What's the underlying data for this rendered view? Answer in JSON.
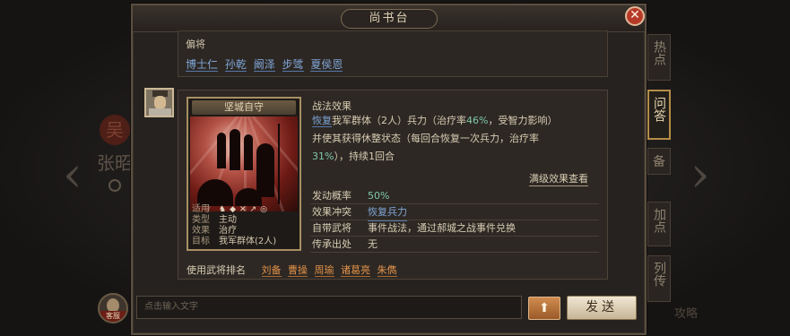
{
  "panel": {
    "title": "尚书台",
    "close_icon": "close-icon"
  },
  "side_tabs": [
    {
      "label": "热点",
      "active": false
    },
    {
      "label": "问答",
      "active": true
    },
    {
      "label": "备",
      "active": false
    },
    {
      "label": "加点",
      "active": false
    },
    {
      "label": "列传",
      "active": false
    }
  ],
  "background": {
    "general_seal": "吴",
    "general_name": "张昭",
    "badge": "攻略"
  },
  "bottom_avatar_label": "客服",
  "top_section": {
    "label": "偏将",
    "names": [
      "博士仁",
      "孙乾",
      "阚泽",
      "步骘",
      "夏侯恩"
    ]
  },
  "card": {
    "name": "坚城自守",
    "info": [
      {
        "key": "适用",
        "value": ""
      },
      {
        "key": "类型",
        "value": "主动"
      },
      {
        "key": "效果",
        "value": "治疗"
      },
      {
        "key": "目标",
        "value": "我军群体(2人)"
      }
    ],
    "icons": [
      "horse-icon",
      "shield-icon",
      "crossed-swords-icon",
      "spear-icon",
      "bow-icon"
    ]
  },
  "effect": {
    "title": "战法效果",
    "line1_kw": "恢复",
    "line1_text": "我军群体（2人）兵力（治疗率",
    "line1_rate": "46%",
    "line1_tail": "，受智力影响）",
    "line2": "并使其获得休整状态（每回合恢复一次兵力，治疗率",
    "line3_rate": "31%",
    "line3_tail": "），持续1回合",
    "full_link": "满级效果查看"
  },
  "stats": [
    {
      "key": "发动概率",
      "value": "50%",
      "style": "green"
    },
    {
      "key": "效果冲突",
      "value": "恢复兵力",
      "style": "blue"
    },
    {
      "key": "自带武将",
      "value": "事件战法，通过郝城之战事件兑换",
      "style": "plain"
    },
    {
      "key": "传承出处",
      "value": "无",
      "style": "plain"
    }
  ],
  "users": {
    "label": "使用武将排名",
    "names": [
      "刘备",
      "曹操",
      "周瑜",
      "诸葛亮",
      "朱儁"
    ]
  },
  "input": {
    "placeholder": "点击输入文字"
  },
  "buttons": {
    "up": "⬆",
    "send": "发送"
  }
}
